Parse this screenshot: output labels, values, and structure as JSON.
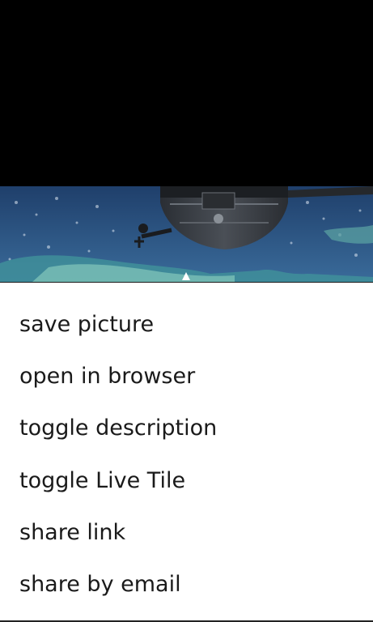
{
  "menu": {
    "items": [
      {
        "label": "save picture"
      },
      {
        "label": "open in browser"
      },
      {
        "label": "toggle description"
      },
      {
        "label": "toggle Live Tile"
      },
      {
        "label": "share link"
      },
      {
        "label": "share by email"
      }
    ]
  },
  "colors": {
    "background": "#000000",
    "menu_background": "#ffffff",
    "menu_text": "#1a1a1a",
    "ocean": "#2b4f7a"
  }
}
